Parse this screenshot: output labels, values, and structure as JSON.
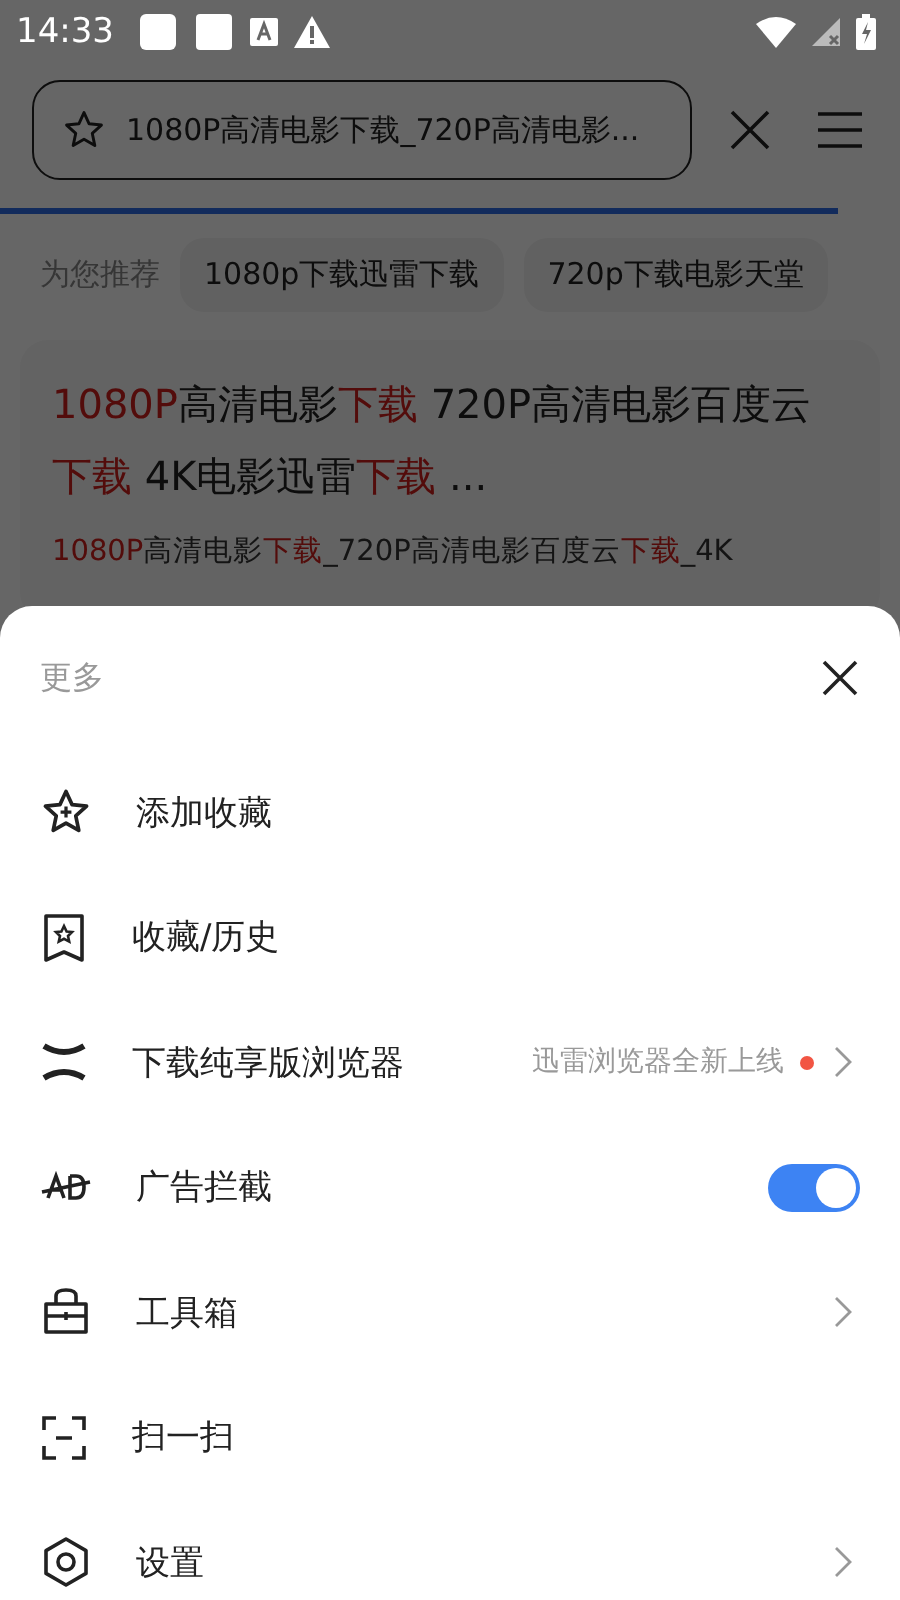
{
  "status_bar": {
    "time": "14:33"
  },
  "address_bar": {
    "title": "1080P高清电影下载_720P高清电影..."
  },
  "suggestions": {
    "label": "为您推荐",
    "chips": [
      "1080p下载迅雷下载",
      "720p下载电影天堂"
    ]
  },
  "result": {
    "title": [
      {
        "text": "1080P",
        "highlight": true
      },
      {
        "text": "高清电影",
        "highlight": false
      },
      {
        "text": "下载",
        "highlight": true
      },
      {
        "text": " 720P高清电影百度云",
        "highlight": false
      },
      {
        "text": "下载",
        "highlight": true
      },
      {
        "text": " 4K电影迅雷",
        "highlight": false
      },
      {
        "text": "下载",
        "highlight": true
      },
      {
        "text": " ...",
        "highlight": false
      }
    ],
    "snippet": [
      {
        "text": "1080P",
        "highlight": true
      },
      {
        "text": "高清电影",
        "highlight": false
      },
      {
        "text": "下载",
        "highlight": true
      },
      {
        "text": "_720P高清电影百度云",
        "highlight": false
      },
      {
        "text": "下载",
        "highlight": true
      },
      {
        "text": "_4K",
        "highlight": false
      }
    ]
  },
  "menu": {
    "title": "更多",
    "items": [
      {
        "kind": "plain",
        "label": "添加收藏"
      },
      {
        "kind": "plain",
        "label": "收藏/历史"
      },
      {
        "kind": "promo",
        "label": "下载纯享版浏览器",
        "note": "迅雷浏览器全新上线",
        "color": "#f25543"
      },
      {
        "kind": "toggle",
        "label": "广告拦截",
        "on": true
      },
      {
        "kind": "link",
        "label": "工具箱"
      },
      {
        "kind": "plain",
        "label": "扫一扫"
      },
      {
        "kind": "link",
        "label": "设置"
      }
    ]
  }
}
